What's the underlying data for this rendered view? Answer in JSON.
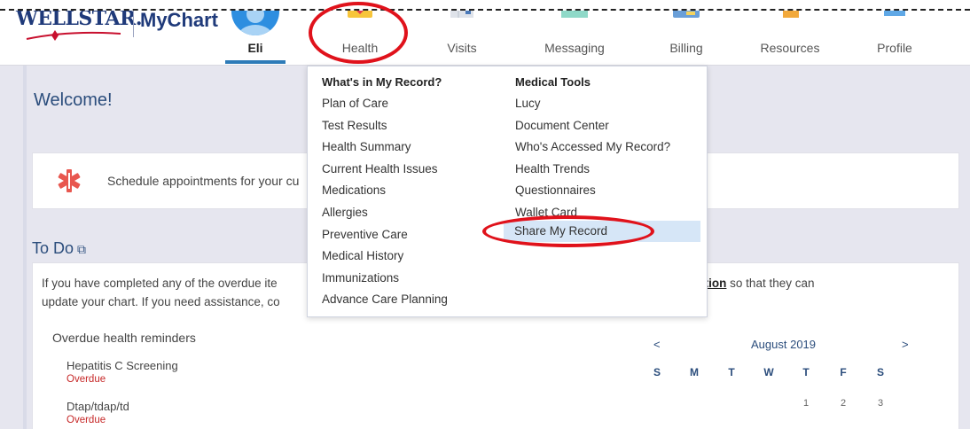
{
  "header": {
    "logo_brand": "WELLSTAR.",
    "logo_product": "MyChart",
    "user_name": "Eli",
    "nav": [
      {
        "label": "Health"
      },
      {
        "label": "Visits"
      },
      {
        "label": "Messaging"
      },
      {
        "label": "Billing"
      },
      {
        "label": "Resources"
      },
      {
        "label": "Profile"
      }
    ]
  },
  "main": {
    "welcome": "Welcome!",
    "schedule_text": "Schedule appointments for your cu",
    "todo_title": "To Do",
    "todo_text_1": "If you have completed any of the overdue ite",
    "todo_text_link": "ing documentation",
    "todo_text_2": " so that they can",
    "todo_text_3": "update your chart. If you need assistance, co",
    "overdue_heading": "Overdue health reminders",
    "overdue_items": [
      {
        "name": "Hepatitis C Screening",
        "status": "Overdue"
      },
      {
        "name": "Dtap/tdap/td",
        "status": "Overdue"
      }
    ]
  },
  "calendar": {
    "prev": "<",
    "next": ">",
    "month": "August 2019",
    "days": [
      "S",
      "M",
      "T",
      "W",
      "T",
      "F",
      "S"
    ],
    "dates": [
      "1",
      "2",
      "3"
    ]
  },
  "dropdown": {
    "left_heading": "What's in My Record?",
    "left_items": [
      "Plan of Care",
      "Test Results",
      "Health Summary",
      "Current Health Issues",
      "Medications",
      "Allergies",
      "Preventive Care",
      "Medical History",
      "Immunizations",
      "Advance Care Planning"
    ],
    "right_heading": "Medical Tools",
    "right_items": [
      "Lucy",
      "Document Center",
      "Who's Accessed My Record?",
      "Health Trends",
      "Questionnaires",
      "Wallet Card",
      "Share My Record"
    ]
  },
  "colors": {
    "accent": "#2b4d7c",
    "annotation": "#e0121b",
    "overdue": "#c62828",
    "highlight": "#d6e6f7"
  }
}
